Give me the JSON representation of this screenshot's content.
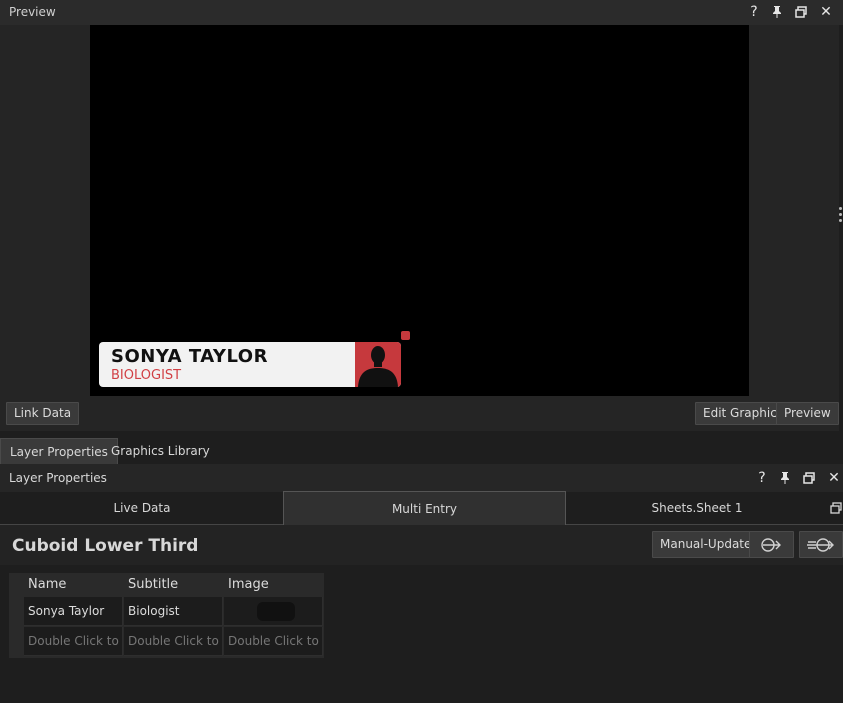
{
  "preview_panel": {
    "title": "Preview",
    "icons": [
      "help-icon",
      "pin-icon",
      "restore-icon",
      "close-icon"
    ],
    "graphic": {
      "name": "SONYA TAYLOR",
      "subtitle": "BIOLOGIST",
      "accent_color": "#c6393d"
    },
    "link_data_label": "Link Data",
    "edit_graphic_label": "Edit Graphic",
    "preview_label": "Preview"
  },
  "bottom_tabs": [
    {
      "label": "Layer Properties",
      "active": true
    },
    {
      "label": "Graphics Library",
      "active": false
    }
  ],
  "layer_properties": {
    "title": "Layer Properties",
    "segments": [
      {
        "label": "Live Data",
        "active": false
      },
      {
        "label": "Multi Entry",
        "active": true
      },
      {
        "label": "Sheets.Sheet 1",
        "active": false
      }
    ],
    "graphic_title": "Cuboid Lower Third",
    "manual_update_label": "Manual-Update",
    "table": {
      "columns": [
        "Name",
        "Subtitle",
        "Image"
      ],
      "rows": [
        [
          "Sonya Taylor",
          "Biologist",
          ""
        ],
        [
          "Double Click to Edit",
          "Double Click to Edit",
          "Double Click to Edit"
        ]
      ]
    }
  }
}
